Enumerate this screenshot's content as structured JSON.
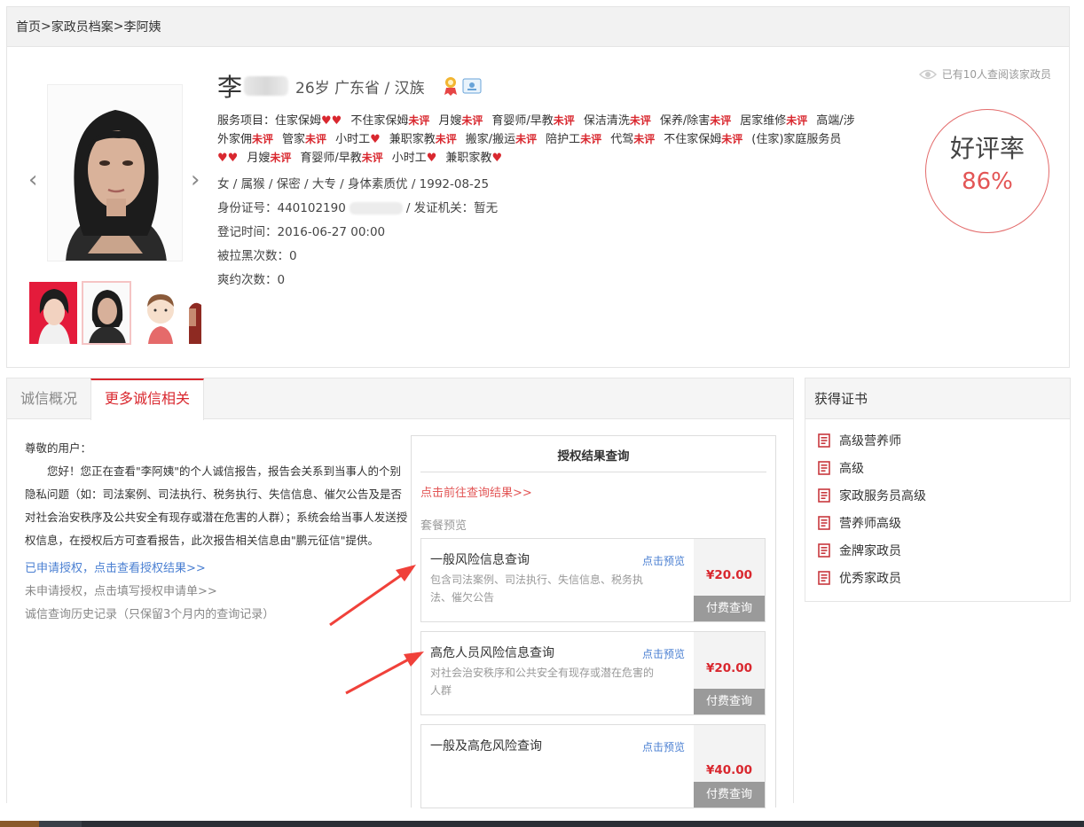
{
  "breadcrumb": {
    "home": "首页",
    "sep1": ">",
    "archive": "家政员档案",
    "sep2": ">",
    "current": "李阿姨"
  },
  "profile": {
    "surname": "李",
    "age": "26岁",
    "province": "广东省",
    "ethnicity": "汉族",
    "meta_sep": "/",
    "services_label": "服务项目：",
    "services": [
      {
        "name": "住家保姆",
        "status": "♥♥"
      },
      {
        "name": "不住家保姆",
        "status": "未评"
      },
      {
        "name": "月嫂",
        "status": "未评"
      },
      {
        "name": "育婴师/早教",
        "status": "未评"
      },
      {
        "name": "保洁清洗",
        "status": "未评"
      },
      {
        "name": "保养/除害",
        "status": "未评"
      },
      {
        "name": "居家维修",
        "status": "未评"
      },
      {
        "name": "高端/涉外家佣",
        "status": "未评"
      },
      {
        "name": "管家",
        "status": "未评"
      },
      {
        "name": "小时工",
        "status": "♥"
      },
      {
        "name": "兼职家教",
        "status": "未评"
      },
      {
        "name": "搬家/搬运",
        "status": "未评"
      },
      {
        "name": "陪护工",
        "status": "未评"
      },
      {
        "name": "代驾",
        "status": "未评"
      },
      {
        "name": "不住家保姆",
        "status": "未评"
      },
      {
        "name": "(住家)家庭服务员",
        "status": "♥♥"
      },
      {
        "name": "月嫂",
        "status": "未评"
      },
      {
        "name": "育婴师/早教",
        "status": "未评"
      },
      {
        "name": "小时工",
        "status": "♥"
      },
      {
        "name": "兼职家教",
        "status": "♥"
      }
    ],
    "basic_line": "女 / 属猴 / 保密 / 大专 / 身体素质优 / 1992-08-25",
    "id_line_prefix": "身份证号：440102190",
    "id_line_suffix": "/ 发证机关：暂无",
    "register_line": "登记时间：2016-06-27 00:00",
    "blacklist_line": "被拉黑次数：0",
    "breach_line": "爽约次数：0",
    "view_note": "已有10人查阅该家政员",
    "rate_label": "好评率",
    "rate_value": "86%"
  },
  "tabs": [
    {
      "label": "诚信概况",
      "active": false
    },
    {
      "label": "更多诚信相关",
      "active": true
    }
  ],
  "notice": {
    "greeting": "尊敬的用户：",
    "body": "您好！您正在查看\"李阿姨\"的个人诚信报告，报告会关系到当事人的个别隐私问题（如：司法案例、司法执行、税务执行、失信信息、催欠公告及是否对社会治安秩序及公共安全有现存或潜在危害的人群）；系统会给当事人发送授权信息，在授权后方可查看报告，此次报告相关信息由\"鹏元征信\"提供。",
    "applied_link": "已申请授权，点击查看授权结果>>",
    "not_applied_link": "未申请授权，点击填写授权申请单>>",
    "history_link": "诚信查询历史记录（只保留3个月内的查询记录）"
  },
  "auth": {
    "title": "授权结果查询",
    "goto_link": "点击前往查询结果>>",
    "packages_heading": "套餐预览",
    "packages": [
      {
        "name": "一般风险信息查询",
        "preview": "点击预览",
        "desc": "包含司法案例、司法执行、失信信息、税务执法、催欠公告",
        "price": "¥20.00",
        "pay": "付费查询"
      },
      {
        "name": "高危人员风险信息查询",
        "preview": "点击预览",
        "desc": "对社会治安秩序和公共安全有现存或潜在危害的人群",
        "price": "¥20.00",
        "pay": "付费查询"
      },
      {
        "name": "一般及高危风险查询",
        "preview": "点击预览",
        "desc": "",
        "price": "¥40.00",
        "pay": "付费查询"
      }
    ]
  },
  "certificates": {
    "heading": "获得证书",
    "items": [
      "高级营养师",
      "高级",
      "家政服务员高级",
      "营养师高级",
      "金牌家政员",
      "优秀家政员"
    ]
  },
  "colors": {
    "accent": "#d9282f",
    "link": "#4a7fd2",
    "annotation_arrow": "#f0413a"
  }
}
